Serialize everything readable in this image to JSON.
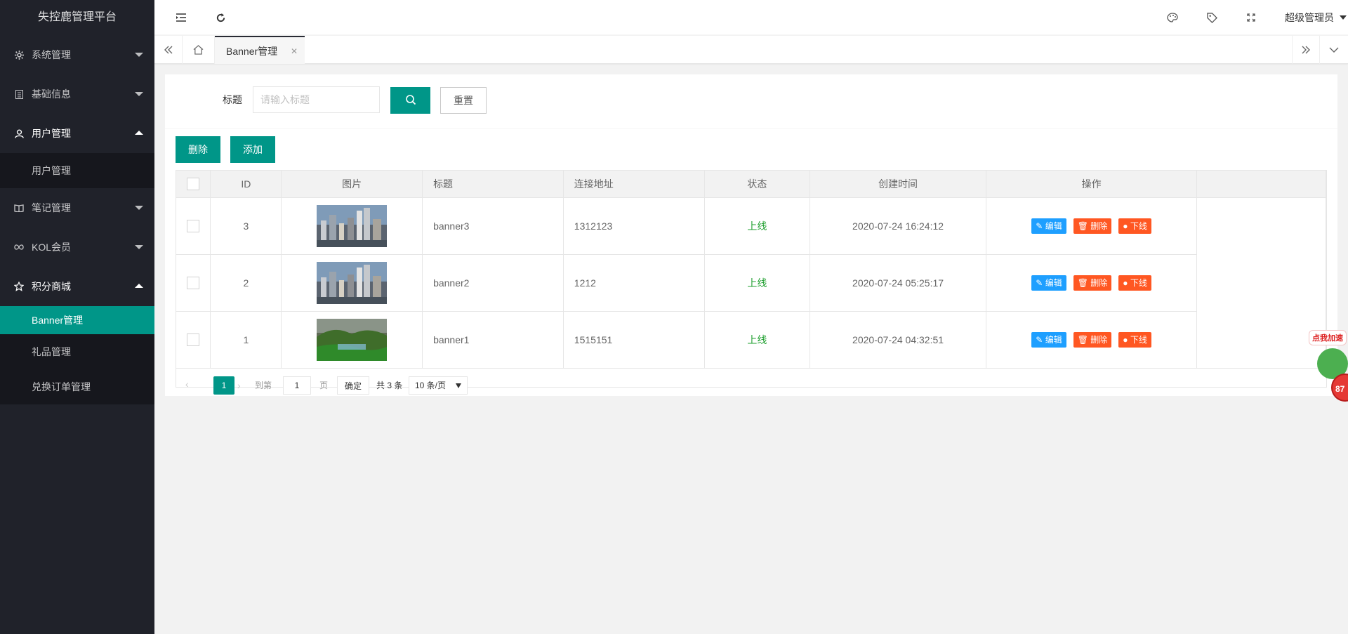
{
  "app": {
    "title": "失控鹿管理平台"
  },
  "sidebar": {
    "groups": [
      {
        "label": "系统管理",
        "icon": "gear-icon",
        "open": false
      },
      {
        "label": "基础信息",
        "icon": "document-icon",
        "open": false
      },
      {
        "label": "用户管理",
        "icon": "user-icon",
        "open": true,
        "items": [
          "用户管理"
        ]
      },
      {
        "label": "笔记管理",
        "icon": "book-icon",
        "open": false
      },
      {
        "label": "KOL会员",
        "icon": "infinity-icon",
        "open": false
      },
      {
        "label": "积分商城",
        "icon": "star-icon",
        "open": true,
        "items": [
          "Banner管理",
          "礼品管理",
          "兑换订单管理"
        ],
        "active": "Banner管理"
      }
    ]
  },
  "header": {
    "icons": [
      "menu-fold-icon",
      "refresh-icon",
      "palette-icon",
      "tag-icon",
      "fullscreen-icon"
    ],
    "user": "超级管理员"
  },
  "tabs": {
    "items": [
      {
        "label": "Banner管理",
        "closable": true
      }
    ]
  },
  "search": {
    "label": "标题",
    "placeholder": "请输入标题",
    "value": "",
    "reset_label": "重置"
  },
  "toolbar": {
    "delete_label": "删除",
    "add_label": "添加"
  },
  "table": {
    "columns": [
      "ID",
      "图片",
      "标题",
      "连接地址",
      "状态",
      "创建时间",
      "操作"
    ],
    "rows": [
      {
        "id": "3",
        "image": "city-skyline",
        "title": "banner3",
        "link": "1312123",
        "status": "上线",
        "created": "2020-07-24 16:24:12"
      },
      {
        "id": "2",
        "image": "city-skyline",
        "title": "banner2",
        "link": "1212",
        "status": "上线",
        "created": "2020-07-24 05:25:17"
      },
      {
        "id": "1",
        "image": "green-landscape",
        "title": "banner1",
        "link": "1515151",
        "status": "上线",
        "created": "2020-07-24 04:32:51"
      }
    ],
    "actions": {
      "edit": "编辑",
      "delete": "删除",
      "offline": "下线"
    }
  },
  "pager": {
    "current": "1",
    "goto_label": "到第",
    "goto_value": "1",
    "page_label": "页",
    "confirm_label": "确定",
    "total_label": "共 3 条",
    "page_size": "10 条/页"
  },
  "widget": {
    "text": "点我加速",
    "badge": "87"
  },
  "colors": {
    "primary": "#009688",
    "sidebar": "#20222a",
    "blue": "#1e9fff",
    "orange": "#ff5722",
    "status_green": "#1e9f2e"
  }
}
